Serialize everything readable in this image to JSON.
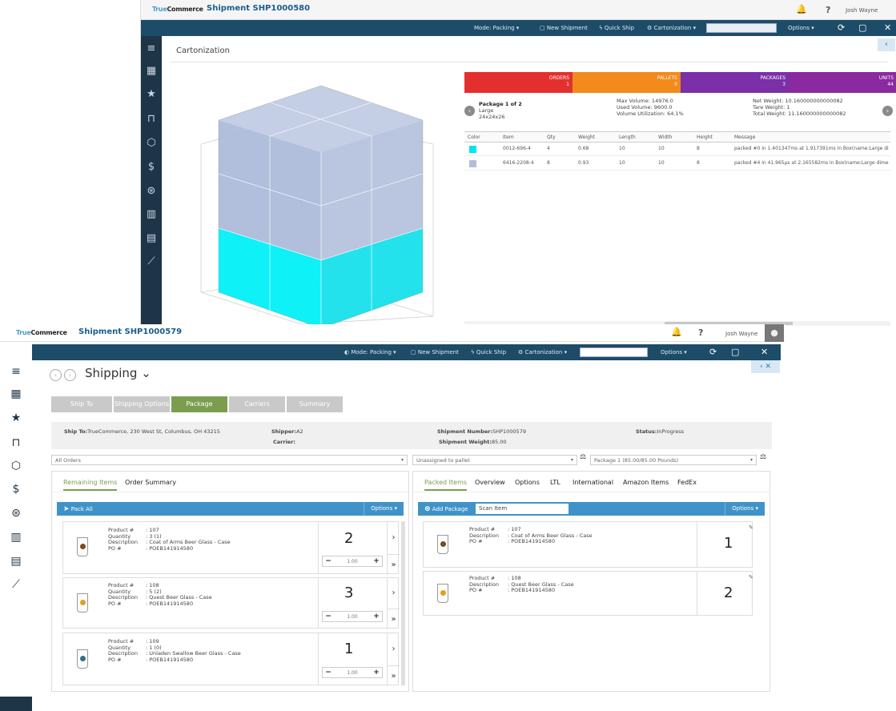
{
  "back": {
    "logo_a": "True",
    "logo_b": "Commerce",
    "shipment_title": "Shipment SHP1000580",
    "user": "Josh Wayne",
    "toolbar": {
      "mode": "Mode: Packing ▾",
      "new_shipment": "New Shipment",
      "quick_ship": "Quick Ship",
      "cartonization": "Cartonization ▾",
      "options": "Options ▾"
    },
    "page_title": "Cartonization",
    "stats": [
      {
        "label": "ORDERS",
        "value": "1",
        "color": "#e3302f"
      },
      {
        "label": "PALLETS",
        "value": "0",
        "color": "#f28a1c"
      },
      {
        "label": "PACKAGES",
        "value": "3",
        "color": "#7b2fa8"
      },
      {
        "label": "UNITS",
        "value": "44",
        "color": "#8a2aa0"
      }
    ],
    "package": {
      "title": "Package 1 of 2",
      "size_name": "Large",
      "dims": "24x24x26",
      "max_volume": "Max Volume: 14976.0",
      "used_volume": "Used Volume: 9600.0",
      "utilization": "Volume Utilization: 64.1%",
      "net_weight": "Net Weight: 10.160000000000082",
      "tare_weight": "Tare Weight: 1",
      "total_weight": "Total Weight: 11.160000000000082"
    },
    "grid_headers": [
      "Color",
      "Item",
      "Qty",
      "Weight",
      "Length",
      "Width",
      "Height",
      "Message"
    ],
    "grid_rows": [
      {
        "color": "#00e5f0",
        "item": "0012-696-4",
        "qty": "4",
        "weight": "0.68",
        "length": "10",
        "width": "10",
        "height": "8",
        "message": "packed #0 in 1.401347ms at 1.917391ms in Box(name:Large di"
      },
      {
        "color": "#b3bed6",
        "item": "6416-2208-4",
        "qty": "8",
        "weight": "0.93",
        "length": "10",
        "width": "10",
        "height": "8",
        "message": "packed #4 in 41.965µs at 2.165582ms in Box(name:Large dime"
      }
    ]
  },
  "front": {
    "logo_a": "True",
    "logo_b": "Commerce",
    "shipment_title": "Shipment SHP1000579",
    "user": "Josh Wayne",
    "toolbar": {
      "mode": "Mode: Packing ▾",
      "new_shipment": "New Shipment",
      "quick_ship": "Quick Ship",
      "cartonization": "Cartonization ▾",
      "options": "Options ▾"
    },
    "page_title": "Shipping ⌄",
    "wizard": [
      "Ship To",
      "Shipping Options",
      "Package",
      "Carriers",
      "Summary"
    ],
    "info": {
      "ship_to_label": "Ship To:",
      "ship_to": "TrueCommerce, 230 West St, Columbus, OH 43215",
      "shipper_label": "Shipper:",
      "shipper": "A2",
      "carrier_label": "Carrier:",
      "shipment_number_label": "Shipment Number:",
      "shipment_number": "SHP1000579",
      "shipment_weight_label": "Shipment Weight:",
      "shipment_weight": "85.00",
      "status_label": "Status:",
      "status": "InProgress"
    },
    "filters": {
      "orders": "All Orders",
      "pallet": "Unassigned to pallet",
      "package": "Package 1 (85.00/85.00 Pounds)"
    },
    "left_tabs": [
      "Remaining Items",
      "Order Summary"
    ],
    "right_tabs": [
      "Packed Items",
      "Overview",
      "Options",
      "LTL",
      "International",
      "Amazon Items",
      "FedEx"
    ],
    "pack_all": "Pack All",
    "options": "Options ▾",
    "add_package": "Add Package",
    "scan_item": "Scan Item",
    "remaining": [
      {
        "product": ": 107",
        "quantity": ": 3 (1)",
        "description": ": Coat of Arms Beer Glass - Case",
        "po": ": POEB141914580",
        "big": "2",
        "step": "1.00",
        "glass_color": "#7a4a1c"
      },
      {
        "product": ": 108",
        "quantity": ": 5 (2)",
        "description": ": Quest Beer Glass - Case",
        "po": ": POEB141914580",
        "big": "3",
        "step": "1.00",
        "glass_color": "#e0a020"
      },
      {
        "product": ": 109",
        "quantity": ": 1 (0)",
        "description": ": Unladen Swallow Beer Glass - Case",
        "po": ": POEB141914580",
        "big": "1",
        "step": "1.00",
        "glass_color": "#3a6a8a"
      }
    ],
    "packed": [
      {
        "product": ": 107",
        "description": ": Coat of Arms Beer Glass - Case",
        "po": ": POEB141914580",
        "big": "1",
        "glass_color": "#7a4a1c"
      },
      {
        "product": ": 108",
        "description": ": Quest Beer Glass - Case",
        "po": ": POEB141914580",
        "big": "2",
        "glass_color": "#e0a020"
      }
    ],
    "labels": {
      "product": "Product #",
      "quantity": "Quantity",
      "description": "Description",
      "po": "PO #"
    }
  }
}
